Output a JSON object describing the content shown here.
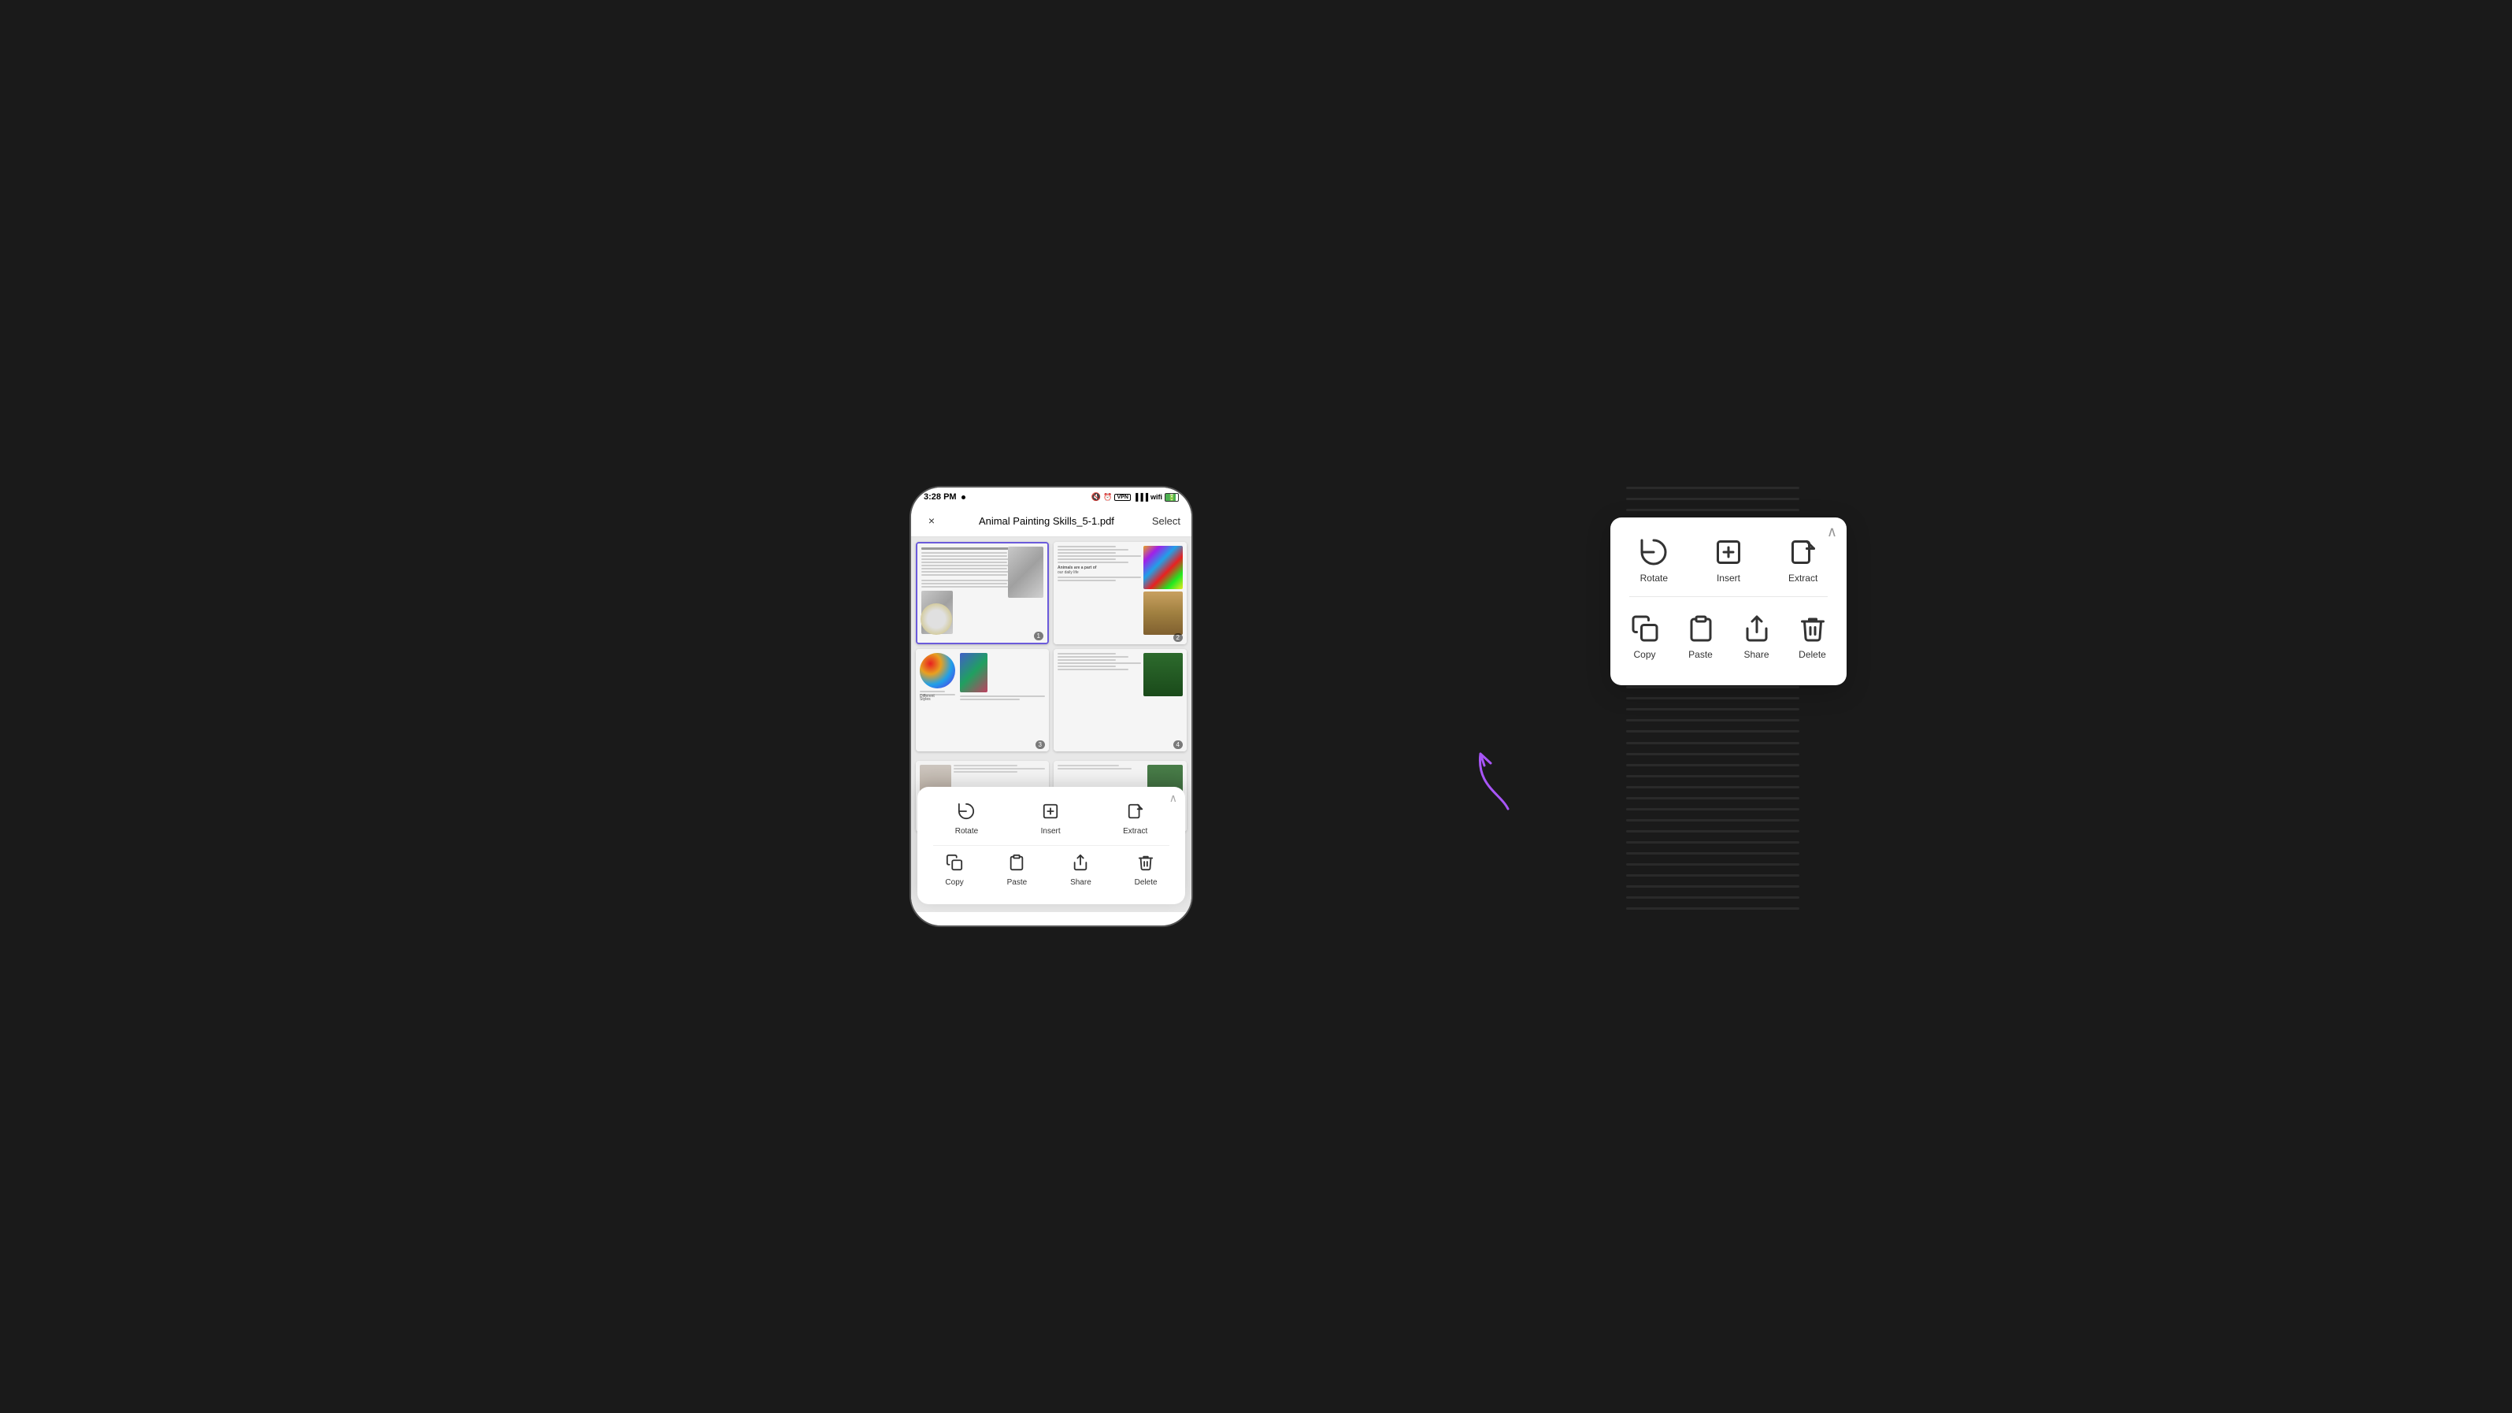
{
  "statusBar": {
    "time": "3:28 PM",
    "hasDot": true
  },
  "header": {
    "title": "Animal Painting Skills_5-1.pdf",
    "closeLabel": "×",
    "selectLabel": "Select"
  },
  "contextMenuLarge": {
    "collapseIcon": "∧",
    "row1": [
      {
        "label": "Rotate",
        "icon": "rotate"
      },
      {
        "label": "Insert",
        "icon": "insert"
      },
      {
        "label": "Extract",
        "icon": "extract"
      }
    ],
    "row2": [
      {
        "label": "Copy",
        "icon": "copy"
      },
      {
        "label": "Paste",
        "icon": "paste"
      },
      {
        "label": "Share",
        "icon": "share"
      },
      {
        "label": "Delete",
        "icon": "delete"
      }
    ]
  },
  "contextMenuSmall": {
    "collapseIcon": "∧",
    "row1": [
      {
        "label": "Rotate",
        "icon": "rotate"
      },
      {
        "label": "Insert",
        "icon": "insert"
      },
      {
        "label": "Extract",
        "icon": "extract"
      }
    ],
    "row2": [
      {
        "label": "Copy",
        "icon": "copy"
      },
      {
        "label": "Paste",
        "icon": "paste"
      },
      {
        "label": "Share",
        "icon": "share"
      },
      {
        "label": "Delete",
        "icon": "delete"
      }
    ]
  },
  "pages": [
    {
      "number": "1",
      "selected": true
    },
    {
      "number": "2",
      "selected": false
    },
    {
      "number": "3",
      "selected": false
    },
    {
      "number": "4",
      "selected": false
    }
  ],
  "colors": {
    "accent": "#6b5bdb",
    "menuBg": "#ffffff",
    "appBg": "#e8e8e8"
  }
}
